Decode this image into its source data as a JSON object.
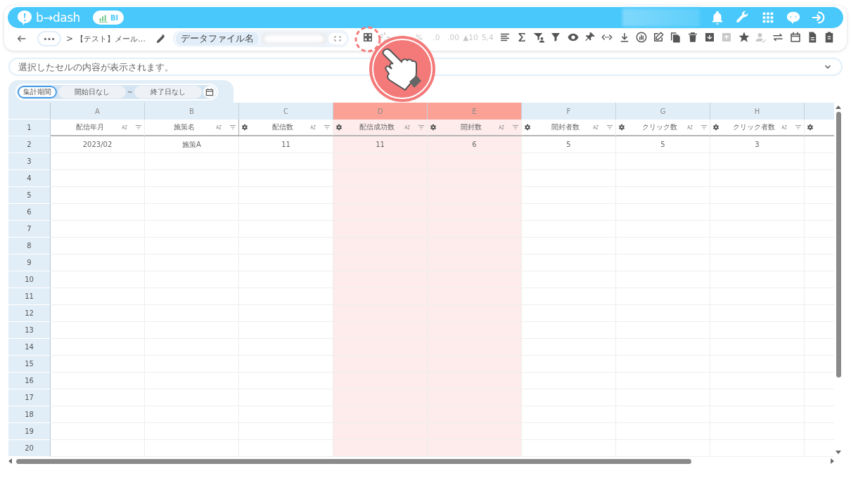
{
  "header": {
    "logo_text": "b→dash",
    "badge": "BI",
    "icons": [
      {
        "kind": "bell"
      },
      {
        "kind": "wrench"
      },
      {
        "kind": "apps"
      },
      {
        "kind": "chat"
      },
      {
        "kind": "sign-in"
      }
    ]
  },
  "toolbar": {
    "breadcrumb_separator": ">",
    "title": "【テスト】メール…",
    "file_label": "データファイル名",
    "tools": [
      {
        "kind": "grid",
        "disabled": false
      },
      {
        "kind": "spark",
        "disabled": true
      },
      {
        "kind": "text",
        "label": "%",
        "disabled": true
      },
      {
        "kind": "text",
        "label": ".0",
        "disabled": true
      },
      {
        "kind": "text",
        "label": ".00",
        "disabled": true
      },
      {
        "kind": "text",
        "label": "▲10",
        "disabled": true
      },
      {
        "kind": "text",
        "label": "5,4",
        "disabled": true
      },
      {
        "kind": "align",
        "disabled": false
      },
      {
        "kind": "sigma",
        "disabled": false
      },
      {
        "kind": "funnel-person",
        "disabled": false
      },
      {
        "kind": "funnel",
        "disabled": false
      },
      {
        "kind": "eye",
        "disabled": false
      },
      {
        "kind": "pin",
        "disabled": false
      },
      {
        "kind": "code",
        "disabled": false
      },
      {
        "kind": "download",
        "disabled": false
      },
      {
        "kind": "chart",
        "disabled": false
      },
      {
        "kind": "edit",
        "disabled": false
      },
      {
        "kind": "copy",
        "disabled": false
      },
      {
        "kind": "trash",
        "disabled": false
      },
      {
        "kind": "archive-down",
        "disabled": false
      },
      {
        "kind": "archive-up",
        "disabled": true
      },
      {
        "kind": "star",
        "disabled": false
      },
      {
        "kind": "person-check",
        "disabled": true
      },
      {
        "kind": "repeat",
        "disabled": false
      },
      {
        "kind": "calendar",
        "disabled": false
      },
      {
        "kind": "document",
        "disabled": false
      },
      {
        "kind": "clipboard",
        "disabled": false
      }
    ]
  },
  "formula_bar": {
    "placeholder": "選択したセルの内容が表示されます。"
  },
  "period_filter": {
    "label": "集計期間",
    "selected": true,
    "start": "開始日なし",
    "separator": "~",
    "end": "終了日なし"
  },
  "sheet": {
    "header_row_number": "1",
    "columns": [
      {
        "letter": "A",
        "label": "配信年月",
        "highlighted": false,
        "settings": false
      },
      {
        "letter": "B",
        "label": "施策名",
        "highlighted": false,
        "settings": false
      },
      {
        "letter": "C",
        "label": "配信数",
        "highlighted": false,
        "settings": true
      },
      {
        "letter": "D",
        "label": "配信成功数",
        "highlighted": true,
        "settings": true
      },
      {
        "letter": "E",
        "label": "開封数",
        "highlighted": true,
        "settings": true
      },
      {
        "letter": "F",
        "label": "開封者数",
        "highlighted": false,
        "settings": true
      },
      {
        "letter": "G",
        "label": "クリック数",
        "highlighted": false,
        "settings": true
      },
      {
        "letter": "H",
        "label": "クリック者数",
        "highlighted": false,
        "settings": true
      },
      {
        "highlighted": false,
        "settings": true
      }
    ],
    "data_rows": [
      {
        "number": "2",
        "cells": [
          "2023/02",
          "施策A",
          "11",
          "11",
          "6",
          "5",
          "5",
          "3"
        ]
      }
    ],
    "empty_rows": [
      "3",
      "4",
      "5",
      "6",
      "7",
      "8",
      "9",
      "10",
      "11",
      "12",
      "13",
      "14",
      "15",
      "16",
      "17",
      "18",
      "19",
      "20"
    ]
  }
}
